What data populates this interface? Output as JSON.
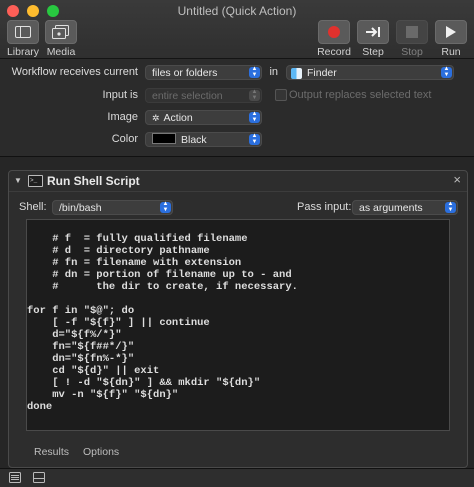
{
  "window": {
    "title": "Untitled (Quick Action)"
  },
  "toolbar": {
    "library": "Library",
    "media": "Media",
    "record": "Record",
    "step": "Step",
    "stop": "Stop",
    "run": "Run"
  },
  "workflow": {
    "receives_label": "Workflow receives current",
    "receives_value": "files or folders",
    "in_label": "in",
    "app_value": "Finder",
    "input_is_label": "Input is",
    "input_is_value": "entire selection",
    "replaces_label": "Output replaces selected text",
    "image_label": "Image",
    "image_value": "Action",
    "color_label": "Color",
    "color_value": "Black"
  },
  "action": {
    "title": "Run Shell Script",
    "close": "×",
    "shell_label": "Shell:",
    "shell_value": "/bin/bash",
    "pass_input_label": "Pass input:",
    "pass_input_value": "as arguments",
    "script_lines": [
      "    # f  = fully qualified filename",
      "    # d  = directory pathname",
      "    # fn = filename with extension",
      "    # dn = portion of filename up to - and",
      "    #      the dir to create, if necessary.",
      "",
      "for f in \"$@\"; do",
      "    [ -f \"${f}\" ] || continue",
      "    d=\"${f%/*}\"",
      "    fn=\"${f##*/}\"",
      "    dn=\"${fn%-*}\"",
      "    cd \"${d}\" || exit",
      "    [ ! -d \"${dn}\" ] && mkdir \"${dn}\"",
      "    mv -n \"${f}\" \"${dn}\"",
      "done"
    ],
    "results_tab": "Results",
    "options_tab": "Options"
  },
  "colors": {
    "accent": "#2b6fde",
    "record_red": "#e0312d"
  }
}
